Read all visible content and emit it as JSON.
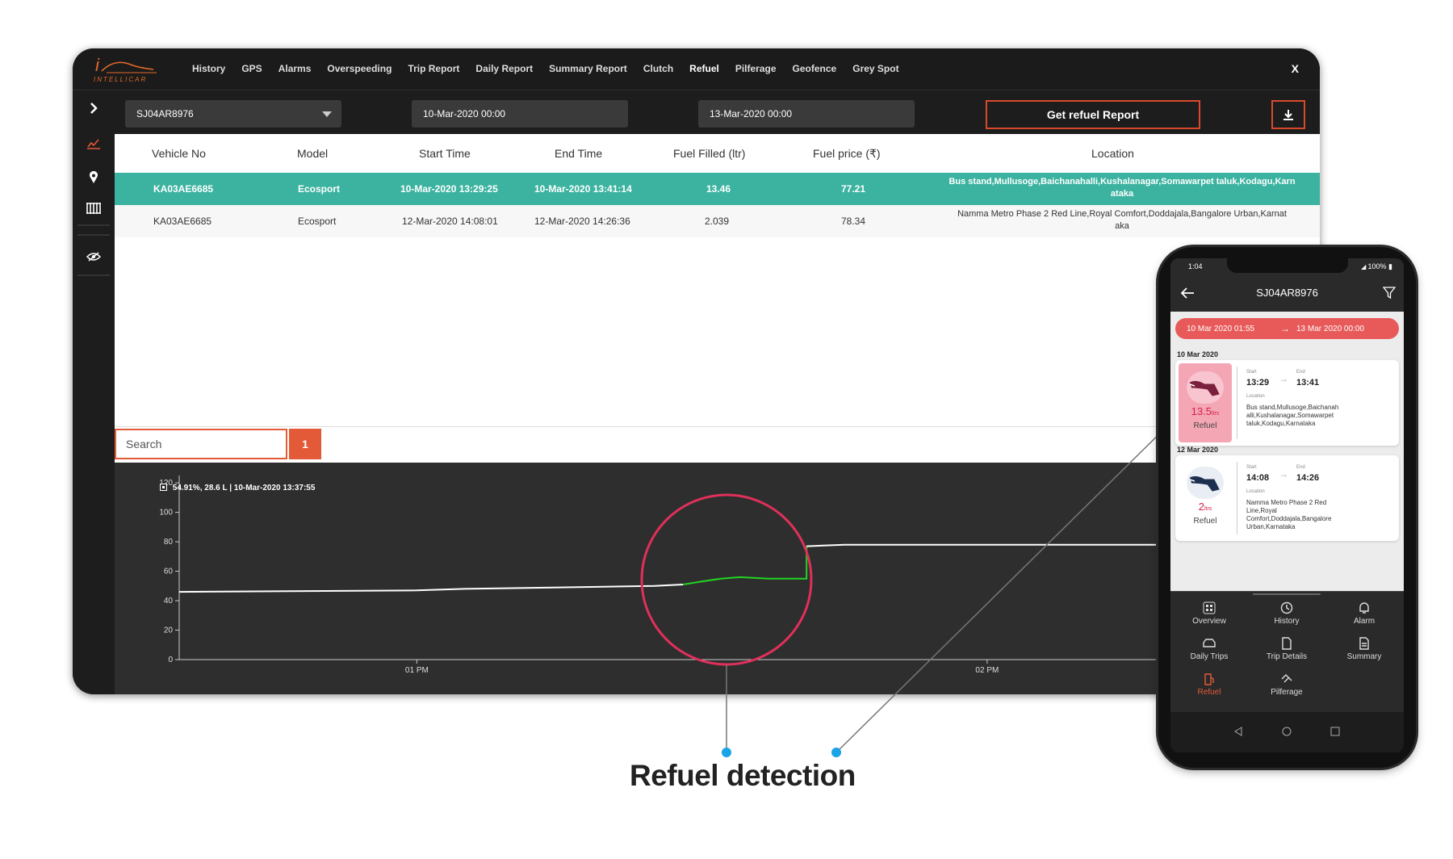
{
  "app": {
    "logo_letter": "i",
    "logo_text": "INTELLICAR",
    "close_label": "X"
  },
  "nav": [
    "History",
    "GPS",
    "Alarms",
    "Overspeeding",
    "Trip Report",
    "Daily Report",
    "Summary Report",
    "Clutch",
    "Refuel",
    "Pilferage",
    "Geofence",
    "Grey Spot"
  ],
  "nav_active": "Refuel",
  "filters": {
    "vehicle": "SJ04AR8976",
    "from": "10-Mar-2020 00:00",
    "to": "13-Mar-2020 00:00",
    "button": "Get refuel Report"
  },
  "table": {
    "headers": [
      "Vehicle No",
      "Model",
      "Start Time",
      "End Time",
      "Fuel Filled (ltr)",
      "Fuel price (₹)",
      "Location"
    ],
    "rows": [
      {
        "vehicle": "KA03AE6685",
        "model": "Ecosport",
        "start": "10-Mar-2020 13:29:25",
        "end": "10-Mar-2020 13:41:14",
        "fuel": "13.46",
        "price": "77.21",
        "loc1": "Bus stand,Mullusoge,Baichanahalli,Kushalanagar,Somawarpet taluk,Kodagu,Karn",
        "loc2": "ataka"
      },
      {
        "vehicle": "KA03AE6685",
        "model": "Ecosport",
        "start": "12-Mar-2020 14:08:01",
        "end": "12-Mar-2020 14:26:36",
        "fuel": "2.039",
        "price": "78.34",
        "loc1": "Namma Metro Phase 2 Red Line,Royal Comfort,Doddajala,Bangalore Urban,Karnat",
        "loc2": "aka"
      }
    ]
  },
  "search": {
    "placeholder": "Search",
    "page": "1"
  },
  "chart_data": {
    "type": "line",
    "legend": "54.91%, 28.6 L | 10-Mar-2020 13:37:55",
    "yticks": [
      0,
      20,
      40,
      60,
      80,
      100,
      120
    ],
    "ylim": [
      0,
      125
    ],
    "xticks": [
      "01 PM",
      "02 PM"
    ],
    "x_range": [
      "12:35",
      "14:35"
    ],
    "series": [
      {
        "color": "#ffffff",
        "points": [
          [
            "12:35",
            46
          ],
          [
            "13:00",
            47
          ],
          [
            "13:05",
            48
          ],
          [
            "13:15",
            49
          ],
          [
            "13:25",
            50
          ],
          [
            "13:28",
            51
          ]
        ]
      },
      {
        "color": "#22d422",
        "points": [
          [
            "13:28",
            51
          ],
          [
            "13:30",
            53
          ],
          [
            "13:32",
            55
          ],
          [
            "13:34",
            56
          ],
          [
            "13:37",
            55
          ],
          [
            "13:40",
            55
          ],
          [
            "13:41",
            55
          ],
          [
            "13:41",
            77
          ]
        ]
      },
      {
        "color": "#ffffff",
        "points": [
          [
            "13:41",
            77
          ],
          [
            "13:45",
            78
          ],
          [
            "14:35",
            78
          ]
        ]
      }
    ]
  },
  "phone": {
    "time": "1:04",
    "battery": "100%",
    "title": "SJ04AR8976",
    "range_from": "10 Mar 2020 01:55",
    "range_to": "13 Mar 2020 00:00",
    "cards": [
      {
        "date": "10 Mar 2020",
        "start_lbl": "Start",
        "start": "13:29",
        "end_lbl": "End",
        "end": "13:41",
        "loc_lbl": "Location",
        "loc": "Bus stand,Mullusoge,Baichanah alli,Kushalanagar,Somawarpet taluk,Kodagu,Karnataka",
        "qty": "13.5",
        "unit": "ltrs",
        "label": "Refuel"
      },
      {
        "date": "12 Mar 2020",
        "start_lbl": "Start",
        "start": "14:08",
        "end_lbl": "End",
        "end": "14:26",
        "loc_lbl": "Location",
        "loc": "Namma Metro Phase 2 Red Line,Royal Comfort,Doddajala,Bangalore Urban,Karnataka",
        "qty": "2",
        "unit": "ltrs",
        "label": "Refuel"
      }
    ],
    "bottom_nav": [
      "Overview",
      "History",
      "Alarm",
      "Daily Trips",
      "Trip Details",
      "Summary",
      "Refuel",
      "Pilferage"
    ]
  },
  "caption": "Refuel detection",
  "colors": {
    "accent": "#e35a38",
    "teal": "#3cb3a0",
    "callout": "#e0305a",
    "dot": "#1aa3e6"
  }
}
